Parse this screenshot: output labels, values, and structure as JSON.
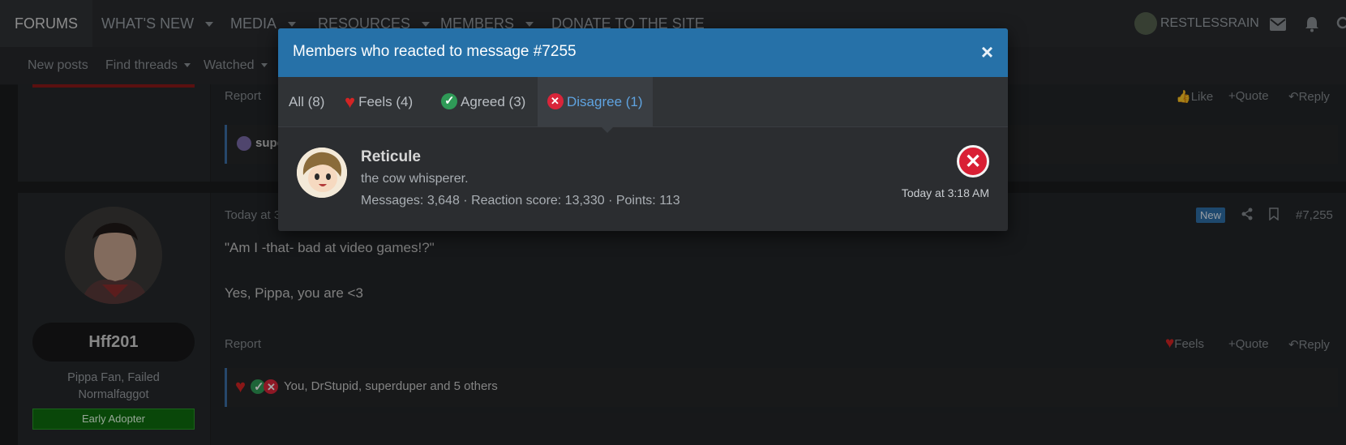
{
  "nav": {
    "items": [
      "FORUMS",
      "WHAT'S NEW",
      "MEDIA",
      "RESOURCES",
      "MEMBERS",
      "DONATE TO THE SITE"
    ],
    "user": "RESTLESSRAIN"
  },
  "subnav": {
    "items": [
      "New posts",
      "Find threads",
      "Watched"
    ]
  },
  "post1": {
    "report": "Report",
    "like": "Like",
    "quote": "Quote",
    "reply": "Reply",
    "reaction_text": "supe"
  },
  "post2": {
    "time_partial": "Today at 3",
    "new_badge": "New",
    "post_number": "#7,255",
    "username": "Hff201",
    "user_title": "Pippa Fan, Failed Normalfaggot",
    "banner": "Early Adopter",
    "lines": [
      "\"Am I -that- bad at video games!?\"",
      "Yes, Pippa, you are <3"
    ],
    "report": "Report",
    "feels": "Feels",
    "quote": "Quote",
    "reply": "Reply",
    "reaction_summary": "You, DrStupid, superduper and 5 others"
  },
  "modal": {
    "title": "Members who reacted to message #7255",
    "close": "×",
    "tabs": {
      "all": "All (8)",
      "feels": "Feels (4)",
      "agreed": "Agreed (3)",
      "disagree": "Disagree (1)"
    },
    "member": {
      "name": "Reticule",
      "title": "the cow whisperer.",
      "stats": "Messages: 3,648 · Reaction score: 13,330 · Points: 113",
      "time": "Today at 3:18 AM",
      "reaction_icon": "disagree-icon"
    }
  },
  "colors": {
    "accent": "#2671a8",
    "active_tab_text": "#5fa3e0",
    "heart": "#d32424",
    "agree": "#2f9a57",
    "disagree": "#d9253a",
    "early_adopter": "#0f6e0f"
  }
}
